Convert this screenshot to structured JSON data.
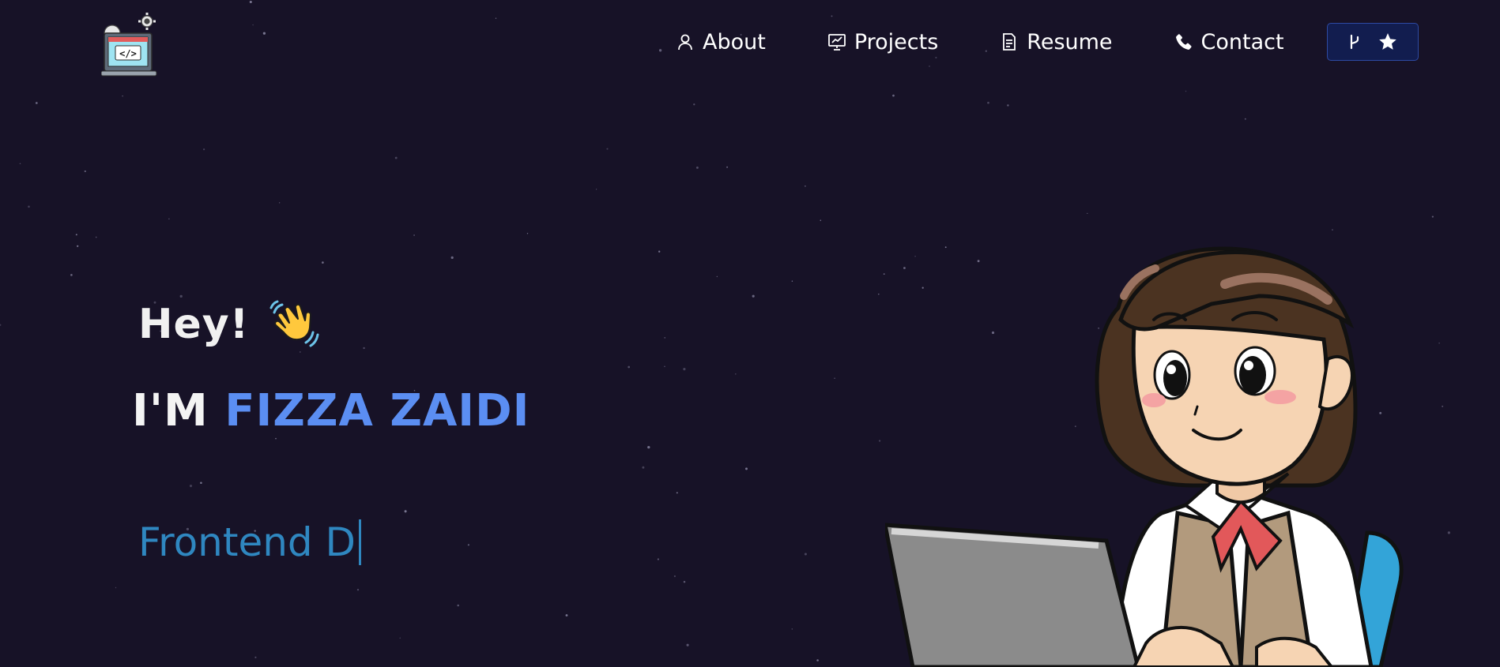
{
  "nav": {
    "items": [
      {
        "label": "About",
        "icon": "user-icon"
      },
      {
        "label": "Projects",
        "icon": "presentation-chart-icon"
      },
      {
        "label": "Resume",
        "icon": "document-icon"
      },
      {
        "label": "Contact",
        "icon": "phone-icon"
      }
    ],
    "github_button": {
      "icons": [
        "git-fork-icon",
        "star-icon"
      ]
    }
  },
  "hero": {
    "greeting": "Hey!",
    "greeting_icon": "waving-hand-icon",
    "name_prefix": "I'M",
    "name": "FIZZA ZAIDI",
    "role_typed": "Frontend D"
  },
  "colors": {
    "background": "#171227",
    "accent_name": "#5b8ef2",
    "role_text": "#2f87c0",
    "github_button_bg": "#121d4f"
  }
}
